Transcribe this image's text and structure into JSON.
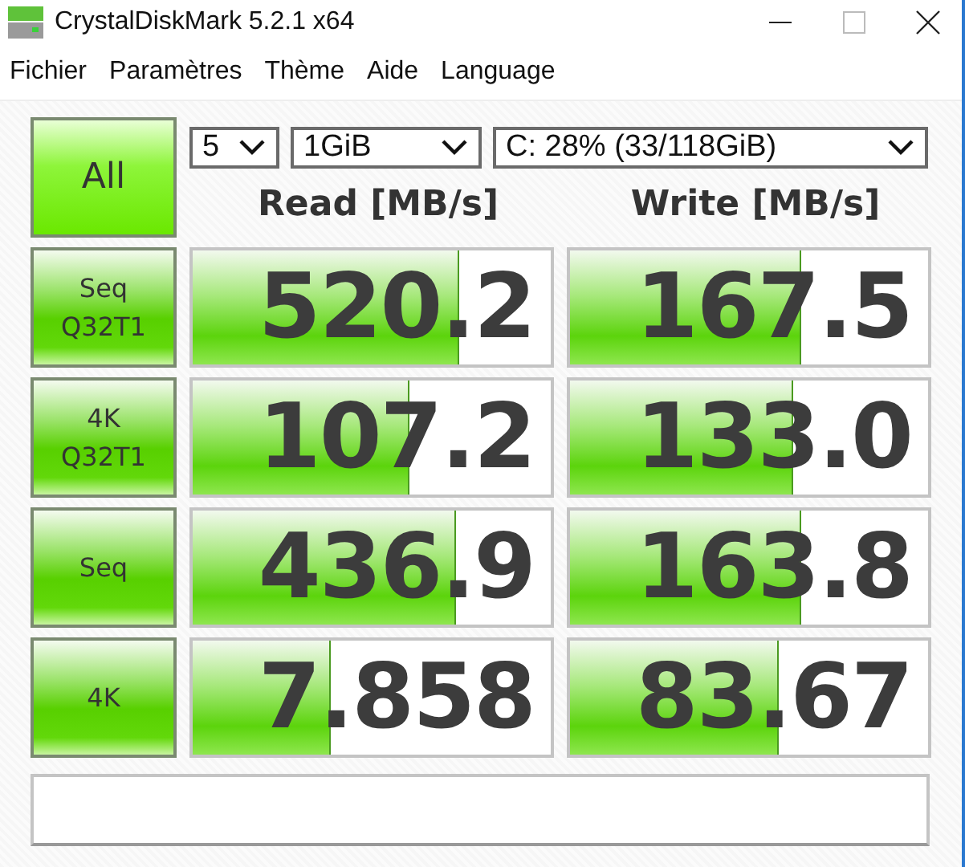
{
  "window": {
    "title": "CrystalDiskMark 5.2.1 x64"
  },
  "menu": [
    "Fichier",
    "Paramètres",
    "Thème",
    "Aide",
    "Language"
  ],
  "all_button": {
    "label": "All"
  },
  "selectors": [
    {
      "value": "5"
    },
    {
      "value": "1GiB"
    },
    {
      "value": "C: 28% (33/118GiB)"
    }
  ],
  "columns": [
    "Read [MB/s]",
    "Write [MB/s]"
  ],
  "rows": [
    {
      "label": "Seq\nQ32T1",
      "read": {
        "value": "520.2",
        "level": 0.74
      },
      "write": {
        "value": "167.5",
        "level": 0.64
      }
    },
    {
      "label": "4K\nQ32T1",
      "read": {
        "value": "107.2",
        "level": 0.6
      },
      "write": {
        "value": "133.0",
        "level": 0.62
      }
    },
    {
      "label": "Seq",
      "read": {
        "value": "436.9",
        "level": 0.73
      },
      "write": {
        "value": "163.8",
        "level": 0.64
      }
    },
    {
      "label": "4K",
      "read": {
        "value": "7.858",
        "level": 0.38
      },
      "write": {
        "value": "83.67",
        "level": 0.58
      }
    }
  ]
}
